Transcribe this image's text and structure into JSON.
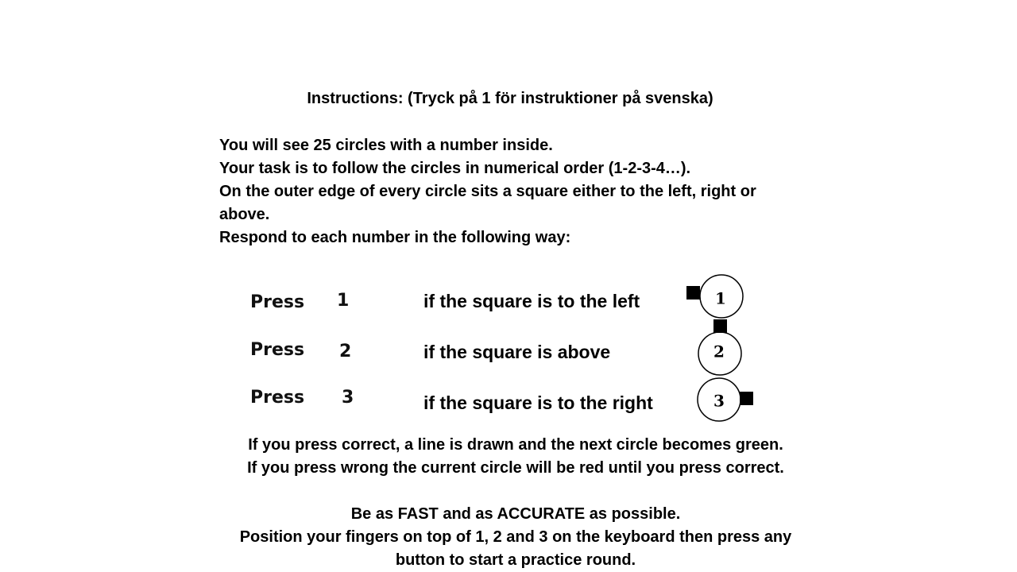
{
  "instructions": {
    "title": "Instructions:  (Tryck på 1 för instruktioner på svenska)",
    "intro": [
      "You will see 25 circles with a number inside.",
      "Your task is to follow the circles in numerical order (1-2-3-4…).",
      "On the outer edge of every circle sits a square either to the left, right or above.",
      "Respond to each number in the following way:"
    ],
    "rules": [
      {
        "press_label": "Press",
        "key": "1",
        "condition": "if the square is to the left",
        "circle_number": "1",
        "square_position": "left"
      },
      {
        "press_label": "Press",
        "key": "2",
        "condition": "if the square is above",
        "circle_number": "2",
        "square_position": "above"
      },
      {
        "press_label": "Press",
        "key": "3",
        "condition": "if the square is to the right",
        "circle_number": "3",
        "square_position": "right"
      }
    ],
    "feedback": [
      "If you press correct, a line is drawn and the next circle becomes green.",
      "If you press wrong the current circle will be red until you press correct."
    ],
    "closing": [
      "Be as FAST and as ACCURATE as possible.",
      "Position your fingers on top of 1, 2 and 3 on the keyboard then press any button to start a practice round."
    ]
  },
  "colors": {
    "background": "#ffffff",
    "text": "#000000"
  }
}
